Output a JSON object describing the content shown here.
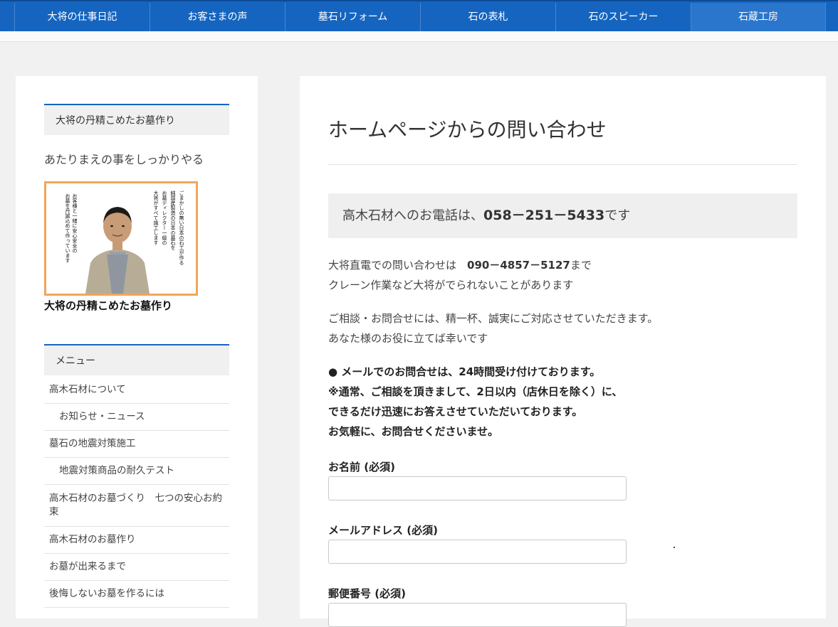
{
  "nav": {
    "items": [
      "大将の仕事日記",
      "お客さまの声",
      "墓石リフォーム",
      "石の表札",
      "石のスピーカー",
      "石蔵工房"
    ]
  },
  "sidebar": {
    "widget_title": "大将の丹精こめたお墓作り",
    "tagline": "あたりまえの事をしっかりやる",
    "photo_caption": "大将の丹精こめたお墓作り",
    "photo_text": [
      "お客様と一緒に安心安全の",
      "お墓を丹誠込めて作っています",
      "ごまかしの無い日本の石工が作る",
      "純国産製造の日本の墓石を",
      "お墓ディレクター一級の",
      "大将がすべて施工します"
    ],
    "menu_title": "メニュー",
    "menu_items": [
      "高木石材について",
      "お知らせ・ニュース",
      "墓石の地震対策施工",
      "地震対策商品の耐久テスト",
      "高木石材のお墓づくり　七つの安心お約束",
      "高木石材のお墓作り",
      "お墓が出来るまで",
      "後悔しないお墓を作るには"
    ]
  },
  "main": {
    "title": "ホームページからの問い合わせ",
    "phone_prefix": "高木石材へのお電話は、",
    "phone_number": "058－251－5433",
    "phone_suffix": "です",
    "direct_prefix": "大将直電での問い合わせは　",
    "direct_number": "090－4857－5127",
    "direct_suffix": "まで",
    "direct_note": "クレーン作業など大将がでられないことがあります",
    "consult_1": "ご相談・お問合せには、精一杯、誠実にご対応させていただきます。",
    "consult_2": "あなた様のお役に立てば幸いです",
    "notice_1": "●  メールでのお問合せは、24時間受け付けております。",
    "notice_2": "※通常、ご相談を頂きまして、2日以内（店休日を除く）に、",
    "notice_3": "できるだけ迅速にお答えさせていただいております。",
    "notice_4": "お気軽に、お問合せくださいませ。",
    "form": {
      "name_label": "お名前 (必須)",
      "email_label": "メールアドレス (必須)",
      "zip_label": "郵便番号 (必須)"
    }
  },
  "colors": {
    "nav_bg": "#1565c0",
    "accent": "#1565c0",
    "photo_border": "#f0a65a"
  }
}
